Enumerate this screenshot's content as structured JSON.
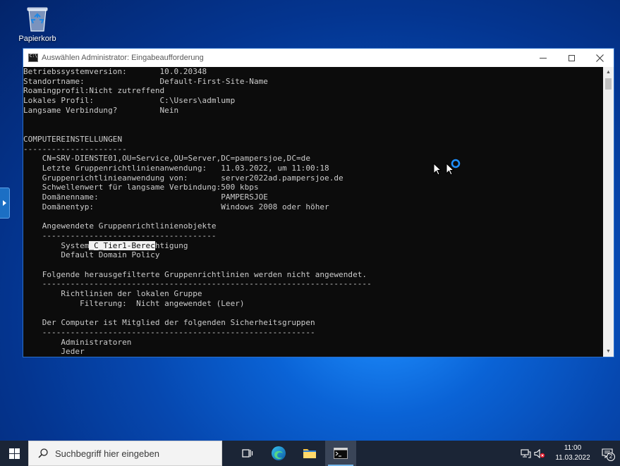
{
  "desktop": {
    "recycle_bin_label": "Papierkorb"
  },
  "window": {
    "title": "Auswählen Administrator: Eingabeaufforderung",
    "minimize_glyph": "—",
    "maximize_glyph": "☐",
    "close_glyph": "✕"
  },
  "console": {
    "lines_before": [
      "Betriebssystemversion:       10.0.20348",
      "Standortname:                Default-First-Site-Name",
      "Roamingprofil:Nicht zutreffend",
      "Lokales Profil:              C:\\Users\\admlump",
      "Langsame Verbindung?         Nein",
      "",
      "",
      "COMPUTEREINSTELLUNGEN",
      "----------------------",
      "    CN=SRV-DIENSTE01,OU=Service,OU=Server,DC=pampersjoe,DC=de",
      "    Letzte Gruppenrichtlinienanwendung:   11.03.2022, um 11:00:18",
      "    Gruppenrichtlinieanwendung von:       server2022ad.pampersjoe.de",
      "    Schwellenwert für langsame Verbindung:500 kbps",
      "    Domänenname:                          PAMPERSJOE",
      "    Domänentyp:                           Windows 2008 oder höher",
      "",
      "    Angewendete Gruppenrichtlinienobjekte",
      "    -------------------------------------"
    ],
    "selected_line": {
      "prefix": "        System",
      "selected": "_C_Tier1-Berec",
      "suffix": "htigung"
    },
    "lines_after": [
      "        Default Domain Policy",
      "",
      "    Folgende herausgefilterte Gruppenrichtlinien werden nicht angewendet.",
      "    ----------------------------------------------------------------------",
      "        Richtlinien der lokalen Gruppe",
      "            Filterung:  Nicht angewendet (Leer)",
      "",
      "    Der Computer ist Mitglied der folgenden Sicherheitsgruppen",
      "    ----------------------------------------------------------",
      "        Administratoren",
      "        Jeder"
    ]
  },
  "taskbar": {
    "search_placeholder": "Suchbegriff hier eingeben",
    "clock_time": "11:00",
    "clock_date": "11.03.2022",
    "notification_count": "2"
  },
  "colors": {
    "console_bg": "#0c0c0c",
    "console_fg": "#cccccc",
    "taskbar_bg": "#1b2536",
    "accent": "#76b9ed"
  }
}
